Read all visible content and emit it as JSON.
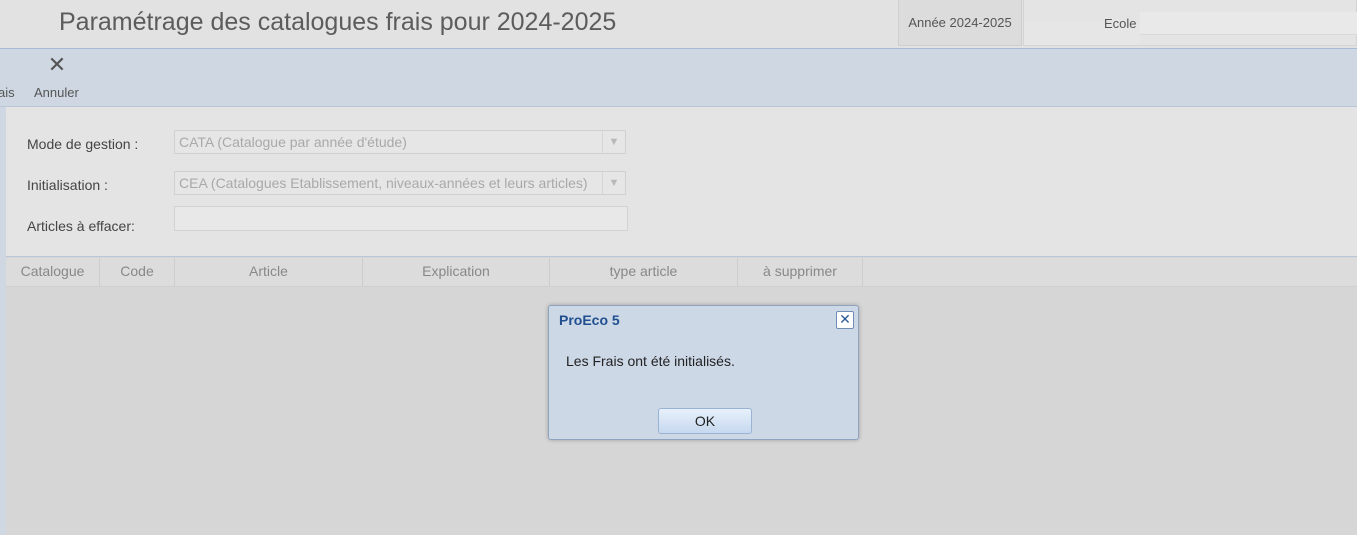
{
  "header": {
    "title": "Paramétrage des catalogues frais pour 2024-2025",
    "year_button": "Année 2024-2025",
    "school_label": "Ecole"
  },
  "toolbar": {
    "partial_label": "ais",
    "cancel_label": "Annuler"
  },
  "form": {
    "mode_label": "Mode de gestion :",
    "mode_value": "CATA (Catalogue par année d'étude)",
    "init_label": "Initialisation :",
    "init_value": "CEA (Catalogues Etablissement, niveaux-années et leurs articles)",
    "articles_label": "Articles à effacer:"
  },
  "grid": {
    "columns": [
      "Catalogue",
      "Code",
      "Article",
      "Explication",
      "type article",
      "à supprimer"
    ]
  },
  "dialog": {
    "title": "ProEco 5",
    "message": "Les Frais ont été initialisés.",
    "ok_label": "OK"
  }
}
